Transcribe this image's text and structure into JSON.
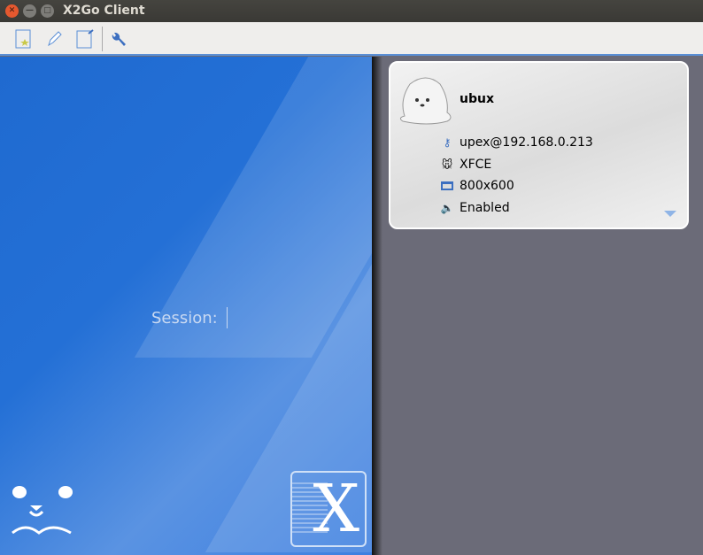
{
  "window": {
    "title": "X2Go Client"
  },
  "toolbar": {
    "items": [
      "new-session",
      "edit-session",
      "session-export",
      "preferences"
    ]
  },
  "login": {
    "session_label": "Session:",
    "session_value": ""
  },
  "session_card": {
    "name": "ubux",
    "server": "upex@192.168.0.213",
    "desktop": "XFCE",
    "resolution": "800x600",
    "sound": "Enabled"
  },
  "colors": {
    "accent": "#2470d6",
    "panel_bg": "#6b6b78"
  }
}
